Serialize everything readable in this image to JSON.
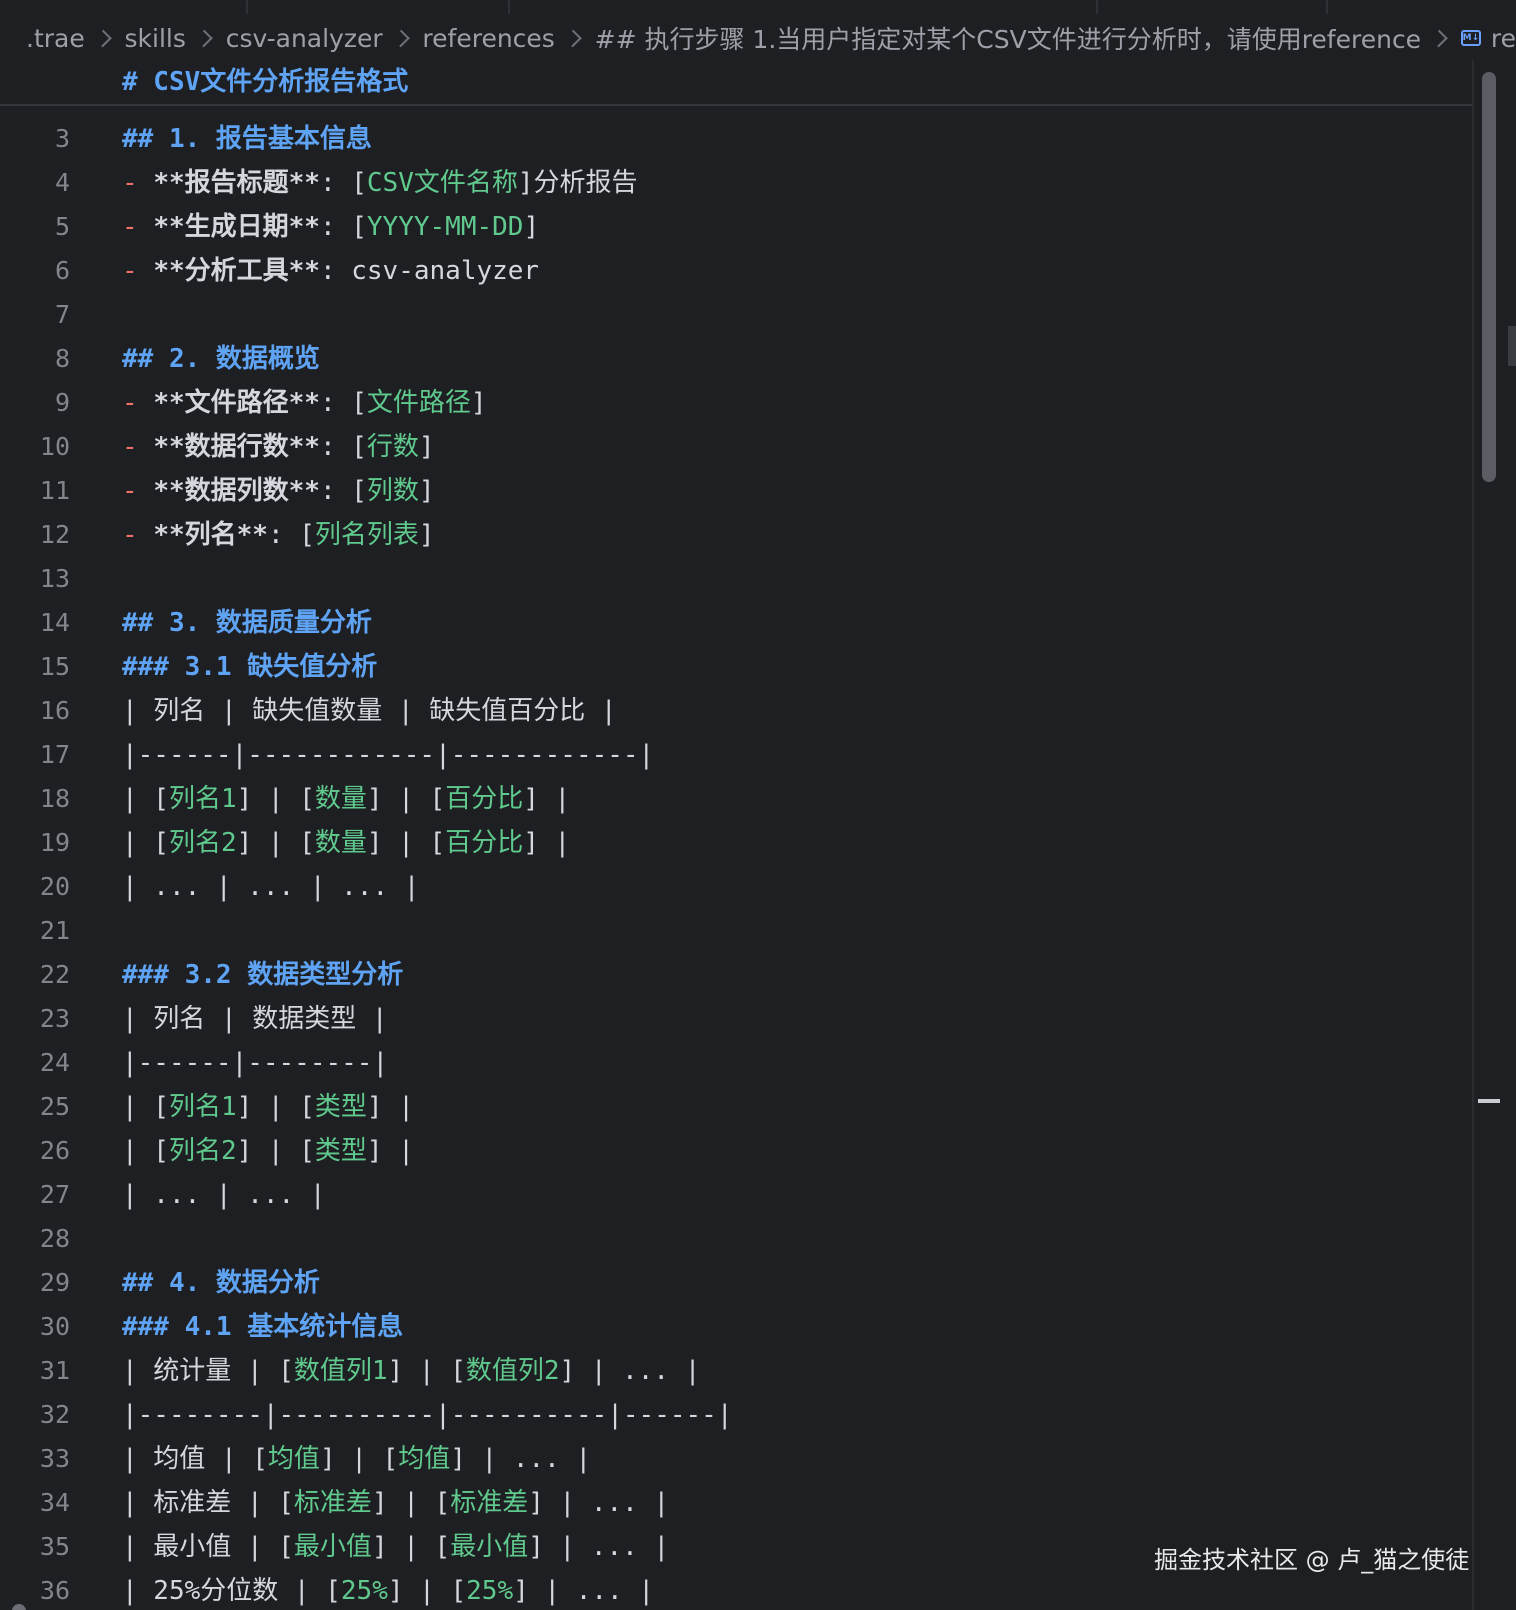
{
  "breadcrumb": {
    "items": [
      ".trae",
      "skills",
      "csv-analyzer",
      "references",
      "## 执行步骤 1.当用户指定对某个CSV文件进行分析时，请使用reference",
      "re"
    ]
  },
  "sticky_header": "# CSV文件分析报告格式",
  "lines": [
    {
      "n": "3",
      "segs": [
        {
          "t": "## 1. 报告基本信息",
          "c": "h"
        }
      ]
    },
    {
      "n": "4",
      "segs": [
        {
          "t": "- ",
          "c": "dash"
        },
        {
          "t": "**报告标题**",
          "c": "b"
        },
        {
          "t": ": [",
          "c": ""
        },
        {
          "t": "CSV文件名称",
          "c": "ph"
        },
        {
          "t": "]分析报告",
          "c": ""
        }
      ]
    },
    {
      "n": "5",
      "segs": [
        {
          "t": "- ",
          "c": "dash"
        },
        {
          "t": "**生成日期**",
          "c": "b"
        },
        {
          "t": ": [",
          "c": ""
        },
        {
          "t": "YYYY-MM-DD",
          "c": "ph"
        },
        {
          "t": "]",
          "c": ""
        }
      ]
    },
    {
      "n": "6",
      "segs": [
        {
          "t": "- ",
          "c": "dash"
        },
        {
          "t": "**分析工具**",
          "c": "b"
        },
        {
          "t": ": csv-analyzer",
          "c": ""
        }
      ]
    },
    {
      "n": "7",
      "segs": []
    },
    {
      "n": "8",
      "segs": [
        {
          "t": "## 2. 数据概览",
          "c": "h"
        }
      ]
    },
    {
      "n": "9",
      "segs": [
        {
          "t": "- ",
          "c": "dash"
        },
        {
          "t": "**文件路径**",
          "c": "b"
        },
        {
          "t": ": [",
          "c": ""
        },
        {
          "t": "文件路径",
          "c": "ph"
        },
        {
          "t": "]",
          "c": ""
        }
      ]
    },
    {
      "n": "10",
      "segs": [
        {
          "t": "- ",
          "c": "dash"
        },
        {
          "t": "**数据行数**",
          "c": "b"
        },
        {
          "t": ": [",
          "c": ""
        },
        {
          "t": "行数",
          "c": "ph"
        },
        {
          "t": "]",
          "c": ""
        }
      ]
    },
    {
      "n": "11",
      "segs": [
        {
          "t": "- ",
          "c": "dash"
        },
        {
          "t": "**数据列数**",
          "c": "b"
        },
        {
          "t": ": [",
          "c": ""
        },
        {
          "t": "列数",
          "c": "ph"
        },
        {
          "t": "]",
          "c": ""
        }
      ]
    },
    {
      "n": "12",
      "segs": [
        {
          "t": "- ",
          "c": "dash"
        },
        {
          "t": "**列名**",
          "c": "b"
        },
        {
          "t": ": [",
          "c": ""
        },
        {
          "t": "列名列表",
          "c": "ph"
        },
        {
          "t": "]",
          "c": ""
        }
      ]
    },
    {
      "n": "13",
      "segs": []
    },
    {
      "n": "14",
      "segs": [
        {
          "t": "## 3. 数据质量分析",
          "c": "h"
        }
      ]
    },
    {
      "n": "15",
      "segs": [
        {
          "t": "### 3.1 缺失值分析",
          "c": "h"
        }
      ]
    },
    {
      "n": "16",
      "segs": [
        {
          "t": "| 列名 | 缺失值数量 | 缺失值百分比 |",
          "c": ""
        }
      ]
    },
    {
      "n": "17",
      "segs": [
        {
          "t": "|------|------------|------------|",
          "c": ""
        }
      ]
    },
    {
      "n": "18",
      "segs": [
        {
          "t": "| [",
          "c": ""
        },
        {
          "t": "列名1",
          "c": "ph"
        },
        {
          "t": "] | [",
          "c": ""
        },
        {
          "t": "数量",
          "c": "ph"
        },
        {
          "t": "] | [",
          "c": ""
        },
        {
          "t": "百分比",
          "c": "ph"
        },
        {
          "t": "] |",
          "c": ""
        }
      ]
    },
    {
      "n": "19",
      "segs": [
        {
          "t": "| [",
          "c": ""
        },
        {
          "t": "列名2",
          "c": "ph"
        },
        {
          "t": "] | [",
          "c": ""
        },
        {
          "t": "数量",
          "c": "ph"
        },
        {
          "t": "] | [",
          "c": ""
        },
        {
          "t": "百分比",
          "c": "ph"
        },
        {
          "t": "] |",
          "c": ""
        }
      ]
    },
    {
      "n": "20",
      "segs": [
        {
          "t": "| ... | ... | ... |",
          "c": ""
        }
      ]
    },
    {
      "n": "21",
      "segs": []
    },
    {
      "n": "22",
      "segs": [
        {
          "t": "### 3.2 数据类型分析",
          "c": "h"
        }
      ]
    },
    {
      "n": "23",
      "segs": [
        {
          "t": "| 列名 | 数据类型 |",
          "c": ""
        }
      ]
    },
    {
      "n": "24",
      "segs": [
        {
          "t": "|------|--------|",
          "c": ""
        }
      ]
    },
    {
      "n": "25",
      "segs": [
        {
          "t": "| [",
          "c": ""
        },
        {
          "t": "列名1",
          "c": "ph"
        },
        {
          "t": "] | [",
          "c": ""
        },
        {
          "t": "类型",
          "c": "ph"
        },
        {
          "t": "] |",
          "c": ""
        }
      ]
    },
    {
      "n": "26",
      "segs": [
        {
          "t": "| [",
          "c": ""
        },
        {
          "t": "列名2",
          "c": "ph"
        },
        {
          "t": "] | [",
          "c": ""
        },
        {
          "t": "类型",
          "c": "ph"
        },
        {
          "t": "] |",
          "c": ""
        }
      ]
    },
    {
      "n": "27",
      "segs": [
        {
          "t": "| ... | ... |",
          "c": ""
        }
      ]
    },
    {
      "n": "28",
      "segs": []
    },
    {
      "n": "29",
      "segs": [
        {
          "t": "## 4. 数据分析",
          "c": "h"
        }
      ]
    },
    {
      "n": "30",
      "segs": [
        {
          "t": "### 4.1 基本统计信息",
          "c": "h"
        }
      ]
    },
    {
      "n": "31",
      "segs": [
        {
          "t": "| 统计量 | [",
          "c": ""
        },
        {
          "t": "数值列1",
          "c": "ph"
        },
        {
          "t": "] | [",
          "c": ""
        },
        {
          "t": "数值列2",
          "c": "ph"
        },
        {
          "t": "] | ... |",
          "c": ""
        }
      ]
    },
    {
      "n": "32",
      "segs": [
        {
          "t": "|--------|----------|----------|------|",
          "c": ""
        }
      ]
    },
    {
      "n": "33",
      "segs": [
        {
          "t": "| 均值 | [",
          "c": ""
        },
        {
          "t": "均值",
          "c": "ph"
        },
        {
          "t": "] | [",
          "c": ""
        },
        {
          "t": "均值",
          "c": "ph"
        },
        {
          "t": "] | ... |",
          "c": ""
        }
      ]
    },
    {
      "n": "34",
      "segs": [
        {
          "t": "| 标准差 | [",
          "c": ""
        },
        {
          "t": "标准差",
          "c": "ph"
        },
        {
          "t": "] | [",
          "c": ""
        },
        {
          "t": "标准差",
          "c": "ph"
        },
        {
          "t": "] | ... |",
          "c": ""
        }
      ]
    },
    {
      "n": "35",
      "segs": [
        {
          "t": "| 最小值 | [",
          "c": ""
        },
        {
          "t": "最小值",
          "c": "ph"
        },
        {
          "t": "] | [",
          "c": ""
        },
        {
          "t": "最小值",
          "c": "ph"
        },
        {
          "t": "] | ... |",
          "c": ""
        }
      ]
    },
    {
      "n": "36",
      "segs": [
        {
          "t": "| 25%分位数 | [",
          "c": ""
        },
        {
          "t": "25%",
          "c": "ph"
        },
        {
          "t": "] | [",
          "c": ""
        },
        {
          "t": "25%",
          "c": "ph"
        },
        {
          "t": "] | ... |",
          "c": ""
        }
      ]
    }
  ],
  "watermark": "掘金技术社区 @ 卢_猫之使徒",
  "colors": {
    "background": "#1e1f22",
    "heading": "#5ea3f4",
    "list_dash": "#f0716a",
    "placeholder": "#60c98d",
    "text": "#d4d7dd",
    "line_number": "#82858c"
  },
  "icons": {
    "file_type": "markdown-file-icon"
  }
}
